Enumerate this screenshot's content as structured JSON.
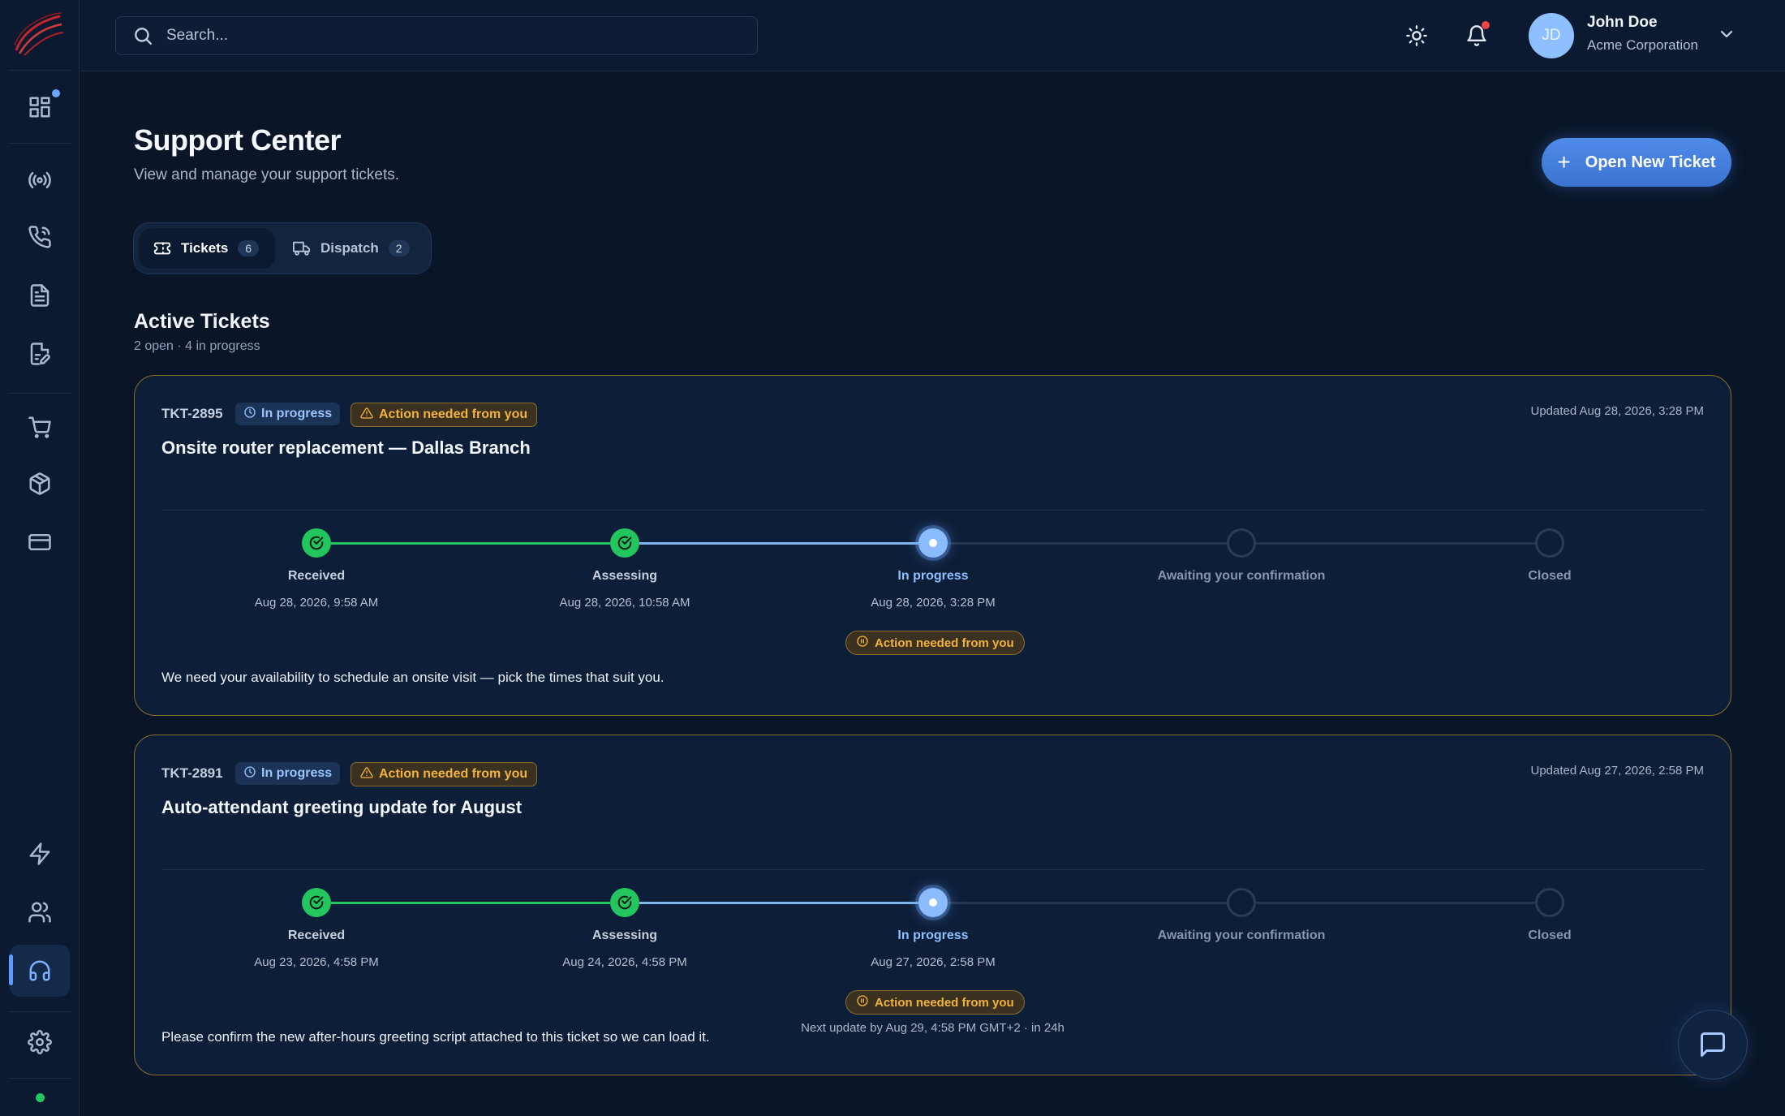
{
  "sidebar": {
    "logo": "company-swoosh-logo",
    "items": [
      {
        "name": "dashboard",
        "icon": "grid-icon"
      },
      {
        "name": "network",
        "icon": "broadcast-icon"
      },
      {
        "name": "voice",
        "icon": "phone-icon"
      },
      {
        "name": "documents",
        "icon": "document-icon"
      },
      {
        "name": "requests",
        "icon": "edit-document-icon"
      },
      {
        "name": "orders",
        "icon": "cart-icon"
      },
      {
        "name": "products",
        "icon": "box-icon"
      },
      {
        "name": "billing",
        "icon": "credit-card-icon"
      },
      {
        "name": "automations",
        "icon": "lightning-icon"
      },
      {
        "name": "users",
        "icon": "users-icon"
      },
      {
        "name": "support",
        "icon": "headset-icon",
        "active": true
      },
      {
        "name": "settings",
        "icon": "gear-icon"
      }
    ]
  },
  "topbar": {
    "search_placeholder": "Search...",
    "user": {
      "initials": "JD",
      "name": "John Doe",
      "org": "Acme Corporation"
    }
  },
  "page": {
    "title": "Support Center",
    "subtitle": "View and manage your support tickets.",
    "new_ticket_label": "Open New Ticket",
    "new_ticket_plus": "+"
  },
  "tabs": [
    {
      "label": "Tickets",
      "count": "6",
      "active": true
    },
    {
      "label": "Dispatch",
      "count": "2",
      "active": false
    }
  ],
  "section": {
    "title": "Active Tickets",
    "subtitle": "2 open · 4 in progress"
  },
  "colors": {
    "accent": "#4f8bea",
    "done": "#22c55e",
    "current": "#8bbcff",
    "warning": "#f3b23a"
  },
  "tickets": [
    {
      "id": "TKT-2895",
      "status": "In progress",
      "action_badge": "Action needed from you",
      "updated": "Updated Aug 28, 2026, 3:28 PM",
      "title": "Onsite router replacement — Dallas Branch",
      "steps": [
        {
          "label": "Received",
          "date": "Aug 28, 2026, 9:58 AM",
          "state": "done"
        },
        {
          "label": "Assessing",
          "date": "Aug 28, 2026, 10:58 AM",
          "state": "done"
        },
        {
          "label": "In progress",
          "date": "Aug 28, 2026, 3:28 PM",
          "state": "current"
        },
        {
          "label": "Awaiting your confirmation",
          "date": "",
          "state": "pending"
        },
        {
          "label": "Closed",
          "date": "",
          "state": "pending"
        }
      ],
      "action_pill": "Action needed from you",
      "next_update": "",
      "description": "We need your availability to schedule an onsite visit — pick the times that suit you."
    },
    {
      "id": "TKT-2891",
      "status": "In progress",
      "action_badge": "Action needed from you",
      "updated": "Updated Aug 27, 2026, 2:58 PM",
      "title": "Auto-attendant greeting update for August",
      "steps": [
        {
          "label": "Received",
          "date": "Aug 23, 2026, 4:58 PM",
          "state": "done"
        },
        {
          "label": "Assessing",
          "date": "Aug 24, 2026, 4:58 PM",
          "state": "done"
        },
        {
          "label": "In progress",
          "date": "Aug 27, 2026, 2:58 PM",
          "state": "current"
        },
        {
          "label": "Awaiting your confirmation",
          "date": "",
          "state": "pending"
        },
        {
          "label": "Closed",
          "date": "",
          "state": "pending"
        }
      ],
      "action_pill": "Action needed from you",
      "next_update": "Next update by Aug 29, 4:58 PM GMT+2 · in 24h",
      "description": "Please confirm the new after-hours greeting script attached to this ticket so we can load it."
    }
  ]
}
